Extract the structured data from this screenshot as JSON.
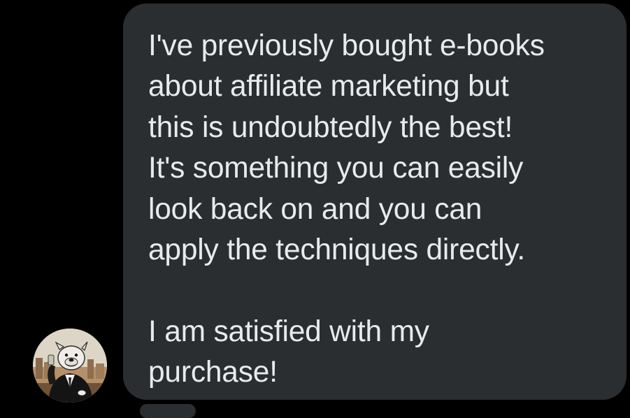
{
  "message": {
    "lines": [
      "I've previously bought e-books",
      "about affiliate marketing but",
      "this is undoubtedly the best!",
      "It's something you can easily",
      "look back on and you can",
      "apply the techniques directly."
    ],
    "closing_lines": [
      "I am satisfied with my",
      "purchase!"
    ]
  },
  "avatar": {
    "icon": "bulldog-in-suit-avatar-icon"
  },
  "colors": {
    "background": "#000000",
    "bubble": "#2a2e30",
    "text": "#e9eaeb"
  }
}
